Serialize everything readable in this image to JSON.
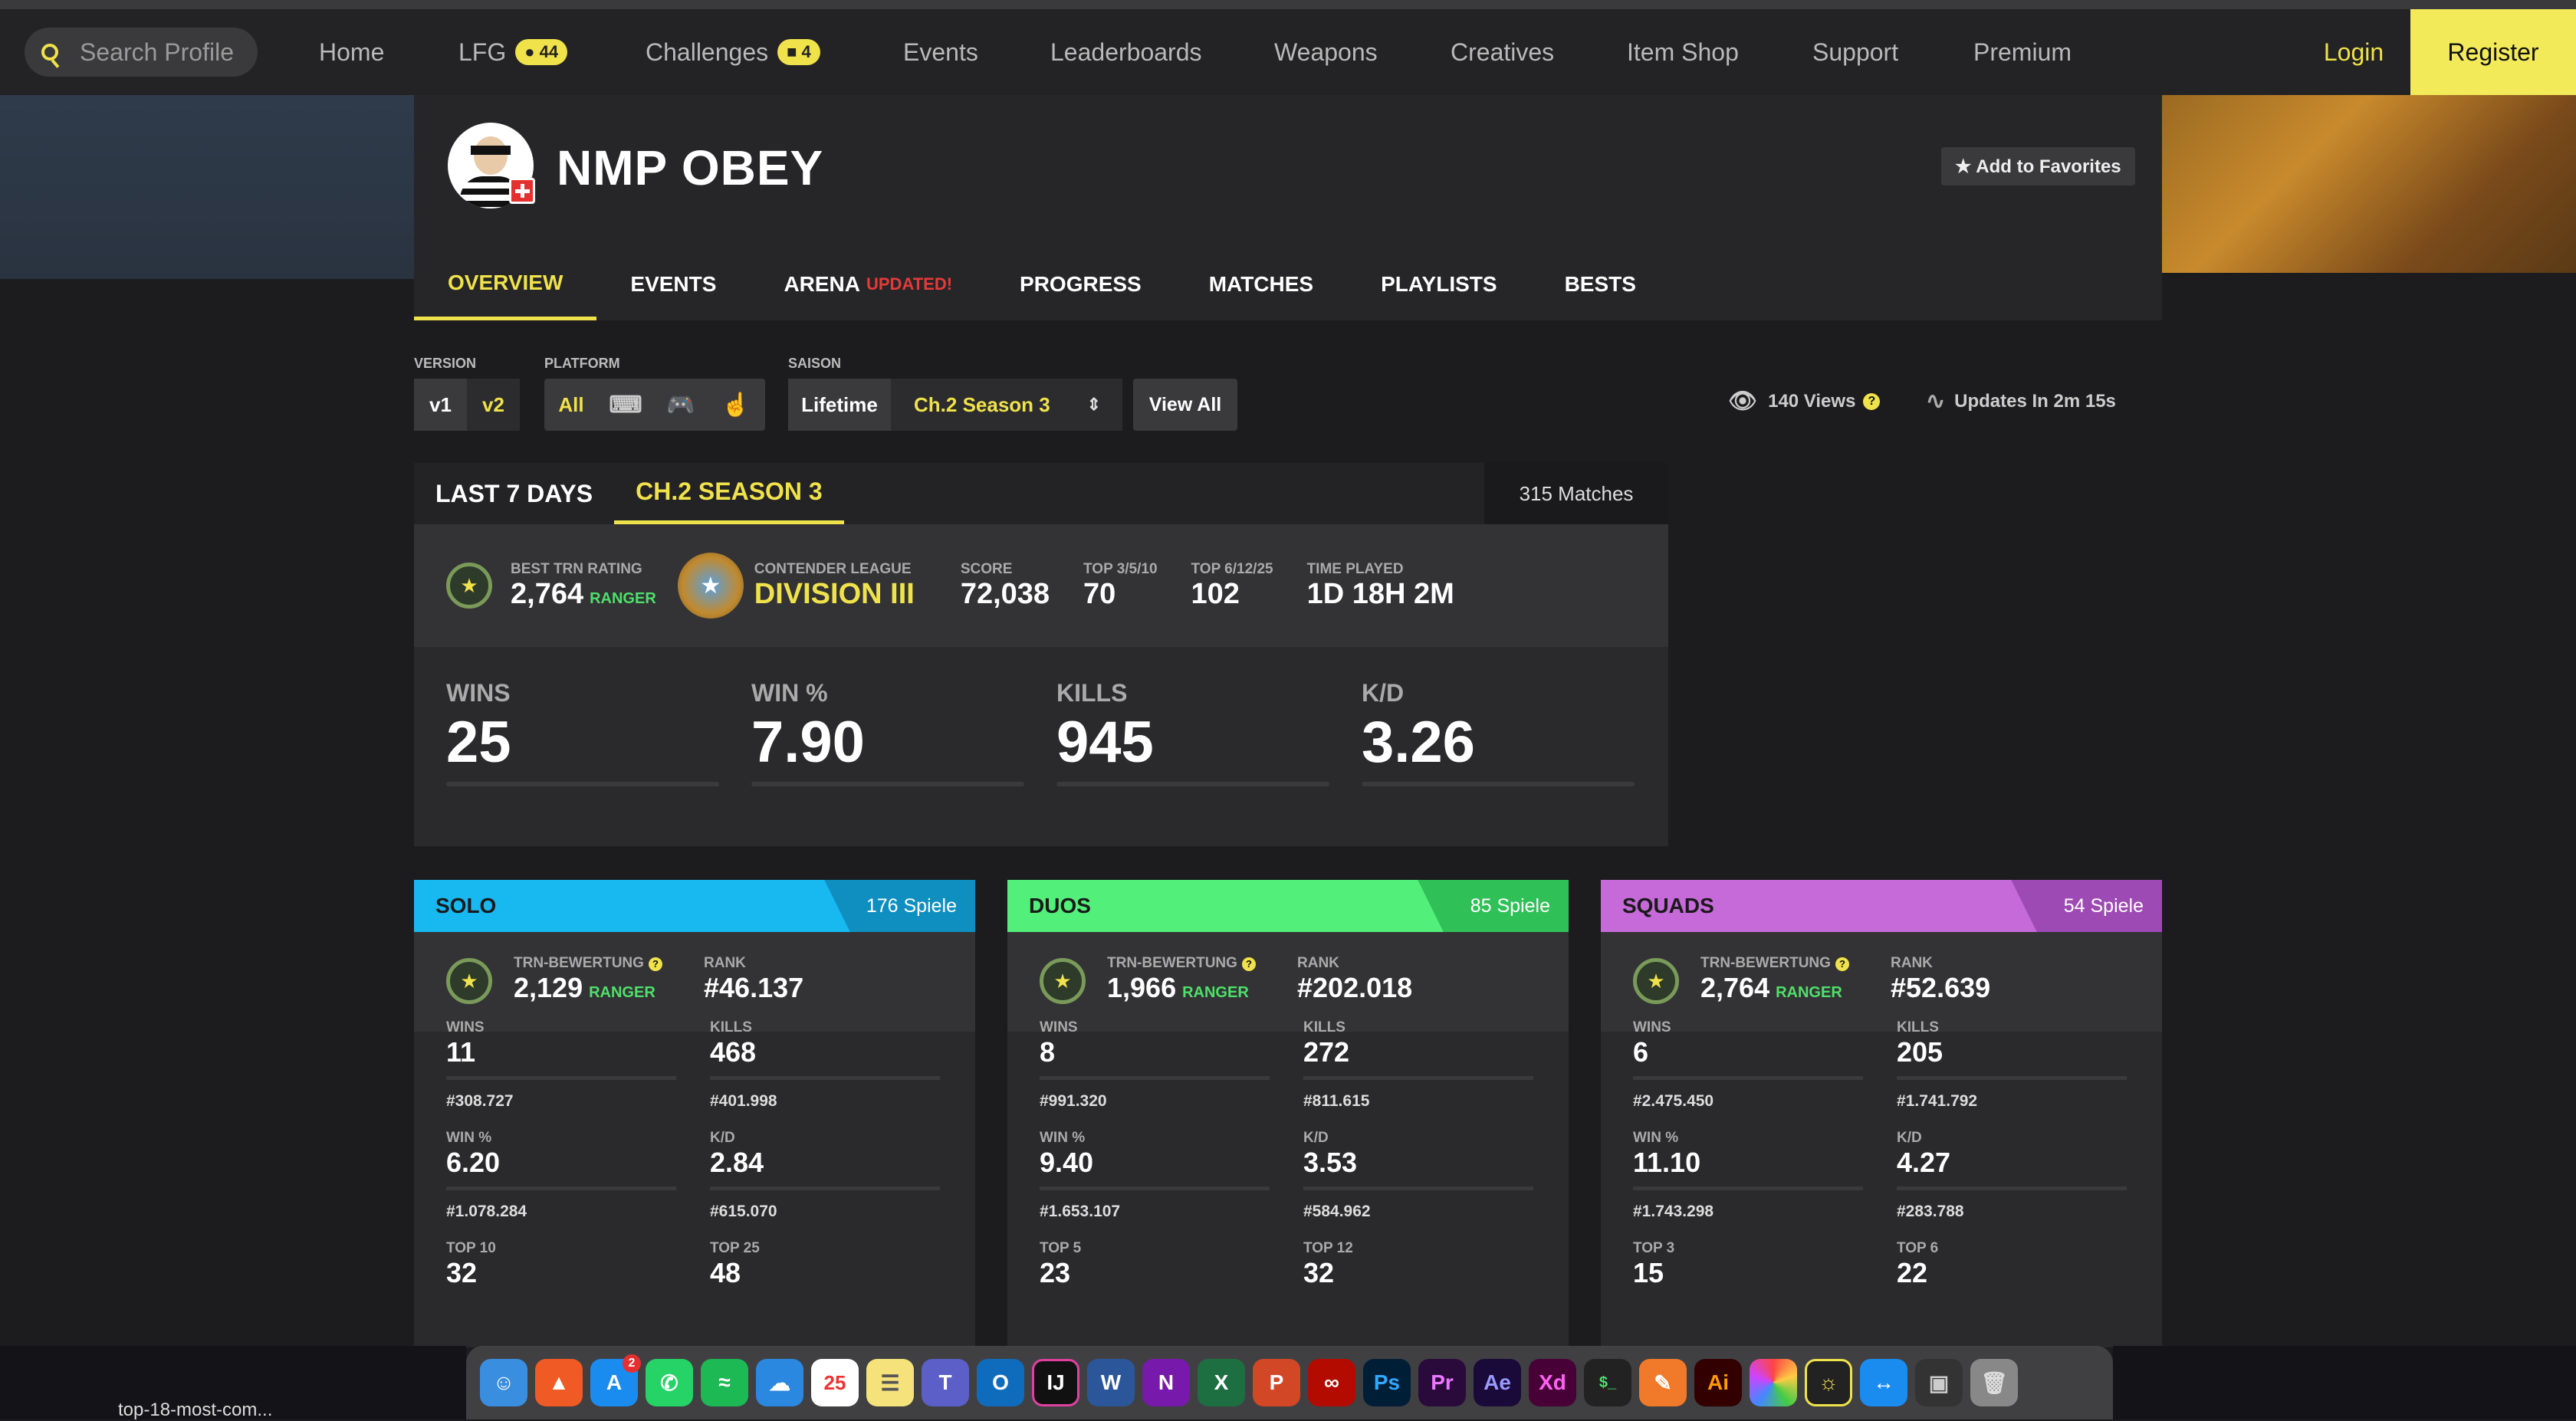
{
  "nav": {
    "search_placeholder": "Search Profile",
    "items": [
      {
        "label": "Home"
      },
      {
        "label": "LFG",
        "badge": "44"
      },
      {
        "label": "Challenges",
        "badge": "4"
      },
      {
        "label": "Events"
      },
      {
        "label": "Leaderboards"
      },
      {
        "label": "Weapons"
      },
      {
        "label": "Creatives"
      },
      {
        "label": "Item Shop"
      },
      {
        "label": "Support"
      },
      {
        "label": "Premium"
      }
    ],
    "login": "Login",
    "register": "Register"
  },
  "profile": {
    "name": "NMP OBEY",
    "favorite_label": "★ Add to Favorites",
    "tabs": [
      {
        "label": "OVERVIEW"
      },
      {
        "label": "EVENTS"
      },
      {
        "label": "ARENA",
        "tag": "UPDATED!"
      },
      {
        "label": "PROGRESS"
      },
      {
        "label": "MATCHES"
      },
      {
        "label": "PLAYLISTS"
      },
      {
        "label": "BESTS"
      }
    ]
  },
  "filters": {
    "version_label": "VERSION",
    "versions": [
      "v1",
      "v2"
    ],
    "platform_label": "PLATFORM",
    "platform_all": "All",
    "season_label": "SAISON",
    "lifetime": "Lifetime",
    "season_value": "Ch.2 Season 3",
    "view_all": "View All",
    "views": "140 Views",
    "updates": "Updates In 2m 15s"
  },
  "season": {
    "tabs": [
      "LAST 7 DAYS",
      "CH.2 SEASON 3"
    ],
    "matches": "315 Matches",
    "best_rating_label": "BEST TRN RATING",
    "best_rating": "2,764",
    "best_rating_tier": "RANGER",
    "league_label": "CONTENDER LEAGUE",
    "league": "DIVISION III",
    "score_label": "SCORE",
    "score": "72,038",
    "top3_label": "TOP 3/5/10",
    "top3": "70",
    "top6_label": "TOP 6/12/25",
    "top6": "102",
    "time_label": "TIME PLAYED",
    "time": "1D 18H 2M",
    "big": [
      {
        "label": "WINS",
        "value": "25"
      },
      {
        "label": "WIN %",
        "value": "7.90"
      },
      {
        "label": "KILLS",
        "value": "945"
      },
      {
        "label": "K/D",
        "value": "3.26"
      }
    ]
  },
  "modes": [
    {
      "name": "SOLO",
      "games": "176 Spiele",
      "color": "#18b9f0",
      "dark": "#0f8fc0",
      "rating_label": "TRN-BEWERTUNG",
      "rating": "2,129",
      "tier": "RANGER",
      "rank_label": "RANK",
      "rank": "#46.137",
      "stats": [
        {
          "label": "WINS",
          "value": "11",
          "pos": "#308.727"
        },
        {
          "label": "KILLS",
          "value": "468",
          "pos": "#401.998"
        },
        {
          "label": "WIN %",
          "value": "6.20",
          "pos": "#1.078.284"
        },
        {
          "label": "K/D",
          "value": "2.84",
          "pos": "#615.070"
        },
        {
          "label": "TOP 10",
          "value": "32"
        },
        {
          "label": "TOP 25",
          "value": "48"
        }
      ]
    },
    {
      "name": "DUOS",
      "games": "85 Spiele",
      "color": "#52f07a",
      "dark": "#30c058",
      "rating_label": "TRN-BEWERTUNG",
      "rating": "1,966",
      "tier": "RANGER",
      "rank_label": "RANK",
      "rank": "#202.018",
      "stats": [
        {
          "label": "WINS",
          "value": "8",
          "pos": "#991.320"
        },
        {
          "label": "KILLS",
          "value": "272",
          "pos": "#811.615"
        },
        {
          "label": "WIN %",
          "value": "9.40",
          "pos": "#1.653.107"
        },
        {
          "label": "K/D",
          "value": "3.53",
          "pos": "#584.962"
        },
        {
          "label": "TOP 5",
          "value": "23"
        },
        {
          "label": "TOP 12",
          "value": "32"
        }
      ]
    },
    {
      "name": "SQUADS",
      "games": "54 Spiele",
      "color": "#c56ad8",
      "dark": "#9e4ab5",
      "rating_label": "TRN-BEWERTUNG",
      "rating": "2,764",
      "tier": "RANGER",
      "rank_label": "RANK",
      "rank": "#52.639",
      "stats": [
        {
          "label": "WINS",
          "value": "6",
          "pos": "#2.475.450"
        },
        {
          "label": "KILLS",
          "value": "205",
          "pos": "#1.741.792"
        },
        {
          "label": "WIN %",
          "value": "11.10",
          "pos": "#1.743.298"
        },
        {
          "label": "K/D",
          "value": "4.27",
          "pos": "#283.788"
        },
        {
          "label": "TOP 3",
          "value": "15"
        },
        {
          "label": "TOP 6",
          "value": "22"
        }
      ]
    }
  ],
  "dock": {
    "calendar_day": "25",
    "appstore_badge": "2",
    "download_name": "top-18-most-com..."
  }
}
